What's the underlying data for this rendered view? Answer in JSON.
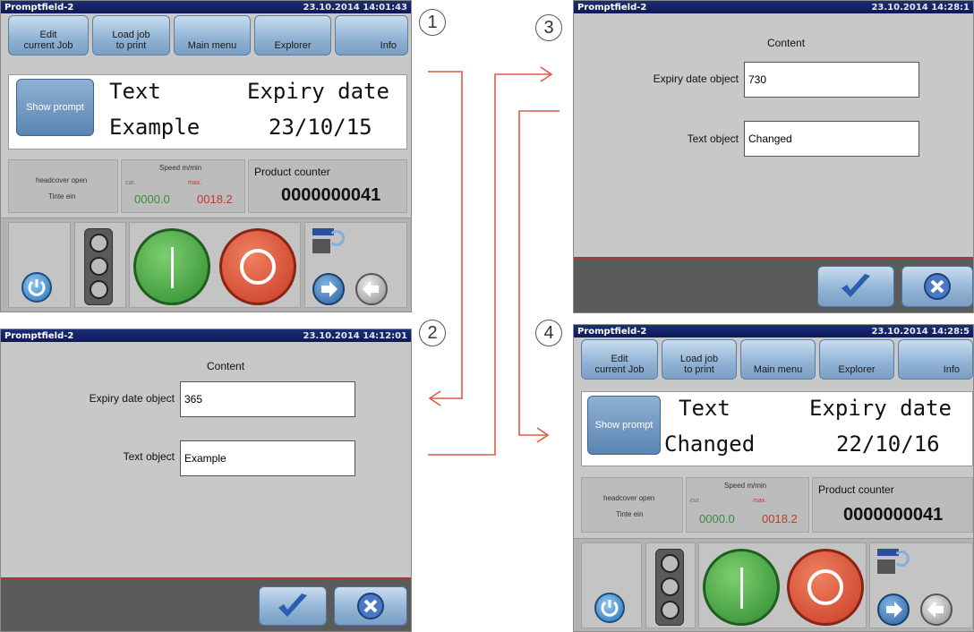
{
  "steps": [
    "1",
    "2",
    "3",
    "4"
  ],
  "main_screen_1": {
    "app_title": "Promptfield-2",
    "datetime": "23.10.2014 14:01:43",
    "toolbar": {
      "edit_line1": "Edit",
      "edit_line2": "current Job",
      "load_line1": "Load job",
      "load_line2": "to print",
      "main_menu": "Main menu",
      "explorer": "Explorer",
      "info": "Info"
    },
    "show_prompt": "Show prompt",
    "col1_header": "Text",
    "col2_header": "Expiry date",
    "col1_value": "Example",
    "col2_value": "23/10/15",
    "status_left_1": "headcover open",
    "status_left_2": "Tinte ein",
    "speed_label": "Speed  m/min",
    "cur_label": "cur.",
    "max_label": "max.",
    "cur_value": "0000.0",
    "max_value": "0018.2",
    "counter_label": "Product counter",
    "counter_value": "0000000041"
  },
  "form_screen_2": {
    "app_title": "Promptfield-2",
    "datetime": "23.10.2014 14:12:01",
    "heading": "Content",
    "expiry_label": "Expiry date object",
    "expiry_value": "365",
    "text_label": "Text object",
    "text_value": "Example"
  },
  "form_screen_3": {
    "app_title": "Promptfield-2",
    "datetime": "23.10.2014 14:28:1",
    "heading": "Content",
    "expiry_label": "Expiry date object",
    "expiry_value": "730",
    "text_label": "Text object",
    "text_value": "Changed"
  },
  "main_screen_4": {
    "app_title": "Promptfield-2",
    "datetime": "23.10.2014 14:28:5",
    "toolbar": {
      "edit_line1": "Edit",
      "edit_line2": "current Job",
      "load_line1": "Load job",
      "load_line2": "to print",
      "main_menu": "Main menu",
      "explorer": "Explorer",
      "info": "Info"
    },
    "show_prompt": "Show prompt",
    "col1_header": "Text",
    "col2_header": "Expiry date",
    "col1_value": "Changed",
    "col2_value": "22/10/16",
    "status_left_1": "headcover open",
    "status_left_2": "Tinte ein",
    "speed_label": "Speed  m/min",
    "cur_label": "cur.",
    "max_label": "max.",
    "cur_value": "0000.0",
    "max_value": "0018.2",
    "counter_label": "Product counter",
    "counter_value": "0000000041"
  },
  "colors": {
    "title_bar": "#0d1a55",
    "arrow": "#e05a45",
    "start_green": "#3f9a3f",
    "stop_red": "#d9432d",
    "speed_cur": "#3a8a3a",
    "speed_max": "#c03a2a",
    "footer_line": "#a33333"
  },
  "icons": [
    "power-icon",
    "traffic-light-icon",
    "start-button-icon",
    "stop-button-icon",
    "printhead-icon",
    "arrow-right-icon",
    "arrow-left-icon",
    "checkmark-icon",
    "cancel-x-icon"
  ]
}
